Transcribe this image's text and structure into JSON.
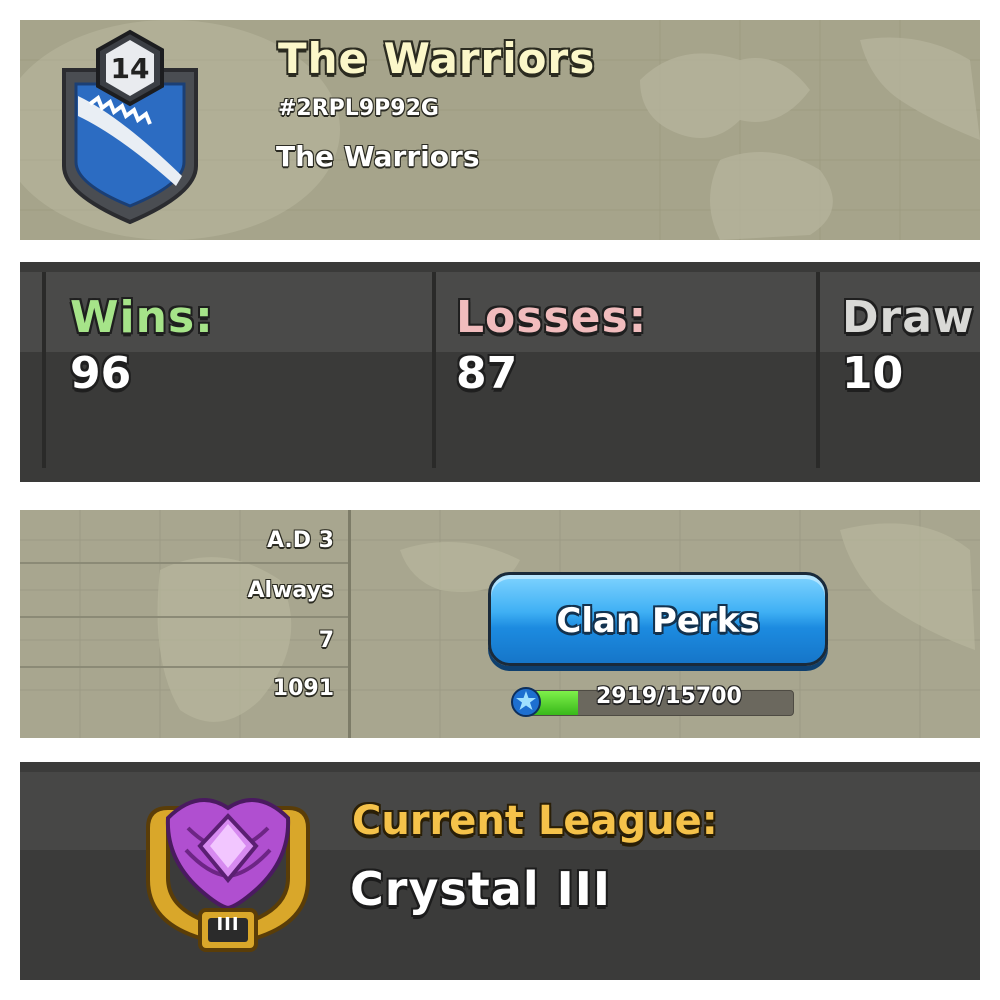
{
  "clan": {
    "level": "14",
    "name": "The Warriors",
    "tag": "#2RPL9P92G",
    "description": "The Warriors"
  },
  "war_record": {
    "wins_label": "Wins:",
    "wins_value": "96",
    "losses_label": "Losses:",
    "losses_value": "87",
    "draws_label": "Draw",
    "draws_value": "10"
  },
  "clan_info": {
    "values": [
      "A.D 3",
      "Always",
      "7",
      "1091"
    ],
    "perks_button_label": "Clan Perks",
    "xp_text": "2919/15700",
    "xp_progress": 0.186
  },
  "league": {
    "label": "Current League:",
    "name": "Crystal III",
    "badge_tier": "III"
  },
  "colors": {
    "wins": "#a6e489",
    "losses": "#f1bcbd",
    "draws": "#d9d9d6",
    "league_label": "#f5c24a",
    "button_blue": "#3fb0f4"
  },
  "icons": [
    "clan-badge-icon",
    "xp-star-icon",
    "crystal-league-icon"
  ]
}
